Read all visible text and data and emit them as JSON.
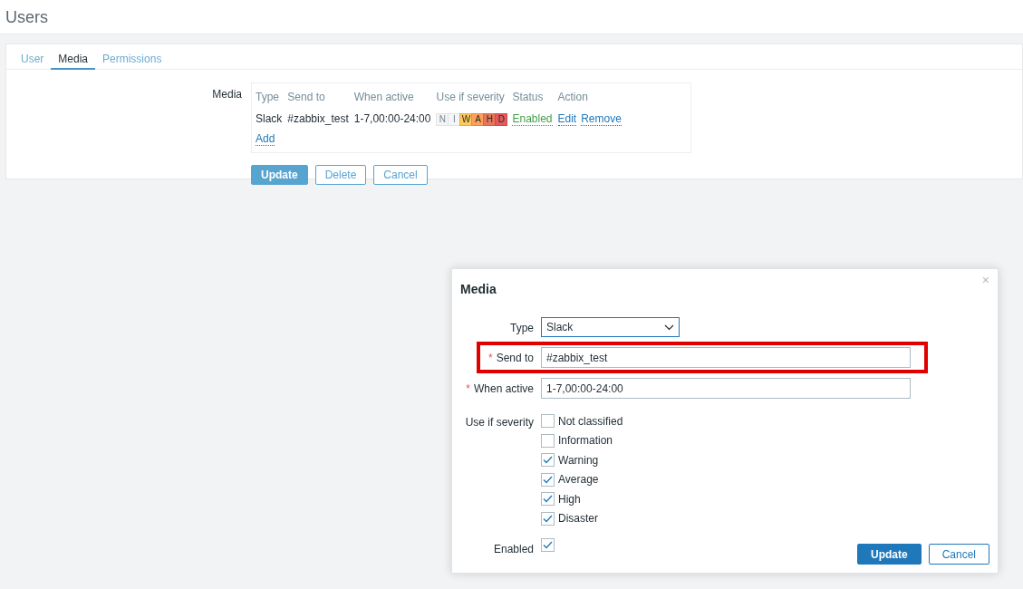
{
  "page": {
    "title": "Users"
  },
  "tabs": [
    {
      "label": "User",
      "selected": false
    },
    {
      "label": "Media",
      "selected": true
    },
    {
      "label": "Permissions",
      "selected": false
    }
  ],
  "media_form": {
    "label": "Media",
    "columns": [
      "Type",
      "Send to",
      "When active",
      "Use if severity",
      "Status",
      "Action"
    ],
    "rows": [
      {
        "type": "Slack",
        "send_to": "#zabbix_test",
        "when_active": "1-7,00:00-24:00",
        "severity": [
          {
            "label": "N",
            "on": false
          },
          {
            "label": "I",
            "on": false
          },
          {
            "label": "W",
            "on": true,
            "color": "#ffc859"
          },
          {
            "label": "A",
            "on": true,
            "color": "#ffa059"
          },
          {
            "label": "H",
            "on": true,
            "color": "#e97659"
          },
          {
            "label": "D",
            "on": true,
            "color": "#e45959"
          }
        ],
        "status": "Enabled",
        "actions": [
          "Edit",
          "Remove"
        ]
      }
    ],
    "add_link": "Add"
  },
  "form_buttons": [
    {
      "label": "Update",
      "primary": true
    },
    {
      "label": "Delete",
      "primary": false
    },
    {
      "label": "Cancel",
      "primary": false
    }
  ],
  "dialog": {
    "title": "Media",
    "close": "×",
    "type": {
      "label": "Type",
      "value": "Slack"
    },
    "send_to": {
      "required_mark": "*",
      "label": "Send to",
      "value": "#zabbix_test",
      "highlighted": true
    },
    "when_active": {
      "required_mark": "*",
      "label": "When active",
      "value": "1-7,00:00-24:00"
    },
    "severity_label": "Use if severity",
    "severities": [
      {
        "label": "Not classified",
        "checked": false
      },
      {
        "label": "Information",
        "checked": false
      },
      {
        "label": "Warning",
        "checked": true
      },
      {
        "label": "Average",
        "checked": true
      },
      {
        "label": "High",
        "checked": true
      },
      {
        "label": "Disaster",
        "checked": true
      }
    ],
    "enabled": {
      "label": "Enabled",
      "checked": true
    },
    "buttons": [
      {
        "label": "Update",
        "primary": true
      },
      {
        "label": "Cancel",
        "primary": false
      }
    ]
  }
}
